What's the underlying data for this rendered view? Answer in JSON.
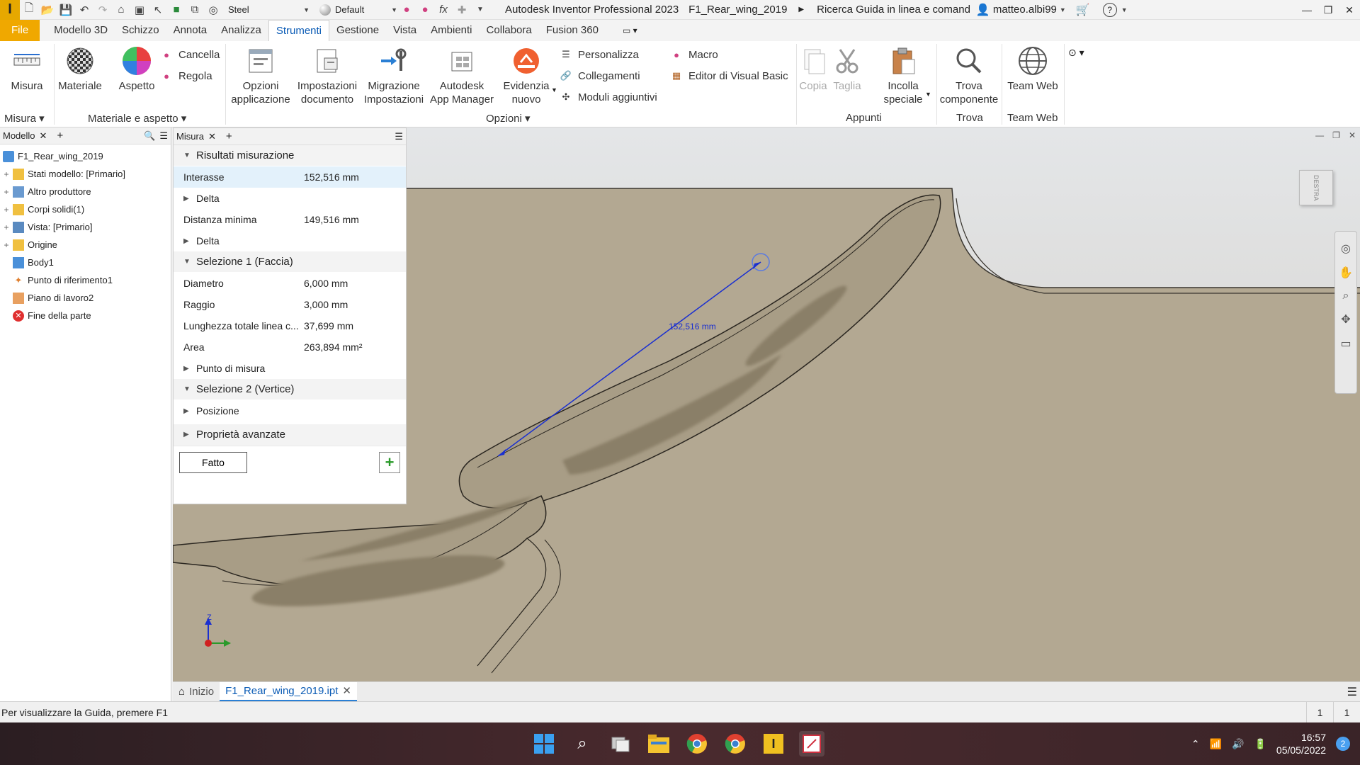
{
  "titlebar": {
    "material": "Steel",
    "appearance": "Default",
    "app_title": "Autodesk Inventor Professional 2023",
    "file_title": "F1_Rear_wing_2019",
    "search_help": "Ricerca Guida in linea e comand",
    "user": "matteo.albi99"
  },
  "ribbon_tabs": [
    "File",
    "Modello 3D",
    "Schizzo",
    "Annota",
    "Analizza",
    "Strumenti",
    "Gestione",
    "Vista",
    "Ambienti",
    "Collabora",
    "Fusion 360"
  ],
  "ribbon_active_tab": "Strumenti",
  "ribbon": {
    "misura": "Misura",
    "materiale": "Materiale",
    "aspetto": "Aspetto",
    "cancella": "Cancella",
    "regola": "Regola",
    "opzioni_app_1": "Opzioni",
    "opzioni_app_2": "applicazione",
    "impost_doc_1": "Impostazioni",
    "impost_doc_2": "documento",
    "migrazione_1": "Migrazione",
    "migrazione_2": "Impostazioni",
    "app_manager_1": "Autodesk",
    "app_manager_2": "App Manager",
    "evidenzia_1": "Evidenzia",
    "evidenzia_2": "nuovo",
    "personalizza": "Personalizza",
    "collegamenti": "Collegamenti",
    "moduli": "Moduli aggiuntivi",
    "macro": "Macro",
    "vba": "Editor di Visual Basic",
    "copia": "Copia",
    "taglia": "Taglia",
    "incolla_1": "Incolla",
    "incolla_2": "speciale",
    "trova_1": "Trova",
    "trova_2": "componente",
    "team_web": "Team Web",
    "groups": {
      "misura": "Misura",
      "materiale_aspetto": "Materiale e aspetto",
      "opzioni": "Opzioni",
      "appunti": "Appunti",
      "trova": "Trova",
      "team_web": "Team Web"
    }
  },
  "browser": {
    "tab": "Modello",
    "items": [
      {
        "label": "F1_Rear_wing_2019",
        "exp": "",
        "indent": 0
      },
      {
        "label": "Stati modello: [Primario]",
        "exp": "+",
        "indent": 1
      },
      {
        "label": "Altro produttore",
        "exp": "+",
        "indent": 1
      },
      {
        "label": "Corpi solidi(1)",
        "exp": "+",
        "indent": 1
      },
      {
        "label": "Vista: [Primario]",
        "exp": "+",
        "indent": 1
      },
      {
        "label": "Origine",
        "exp": "+",
        "indent": 1
      },
      {
        "label": "Body1",
        "exp": "",
        "indent": 1
      },
      {
        "label": "Punto di riferimento1",
        "exp": "",
        "indent": 1
      },
      {
        "label": "Piano di lavoro2",
        "exp": "",
        "indent": 1
      },
      {
        "label": "Fine della parte",
        "exp": "",
        "indent": 1
      }
    ]
  },
  "measure": {
    "tab": "Misura",
    "sec_results": "Risultati misurazione",
    "interasse_label": "Interasse",
    "interasse_val": "152,516 mm",
    "delta1": "Delta",
    "dist_min_label": "Distanza minima",
    "dist_min_val": "149,516 mm",
    "delta2": "Delta",
    "sec_sel1": "Selezione 1 (Faccia)",
    "diametro_label": "Diametro",
    "diametro_val": "6,000 mm",
    "raggio_label": "Raggio",
    "raggio_val": "3,000 mm",
    "lunghezza_label": "Lunghezza totale linea c...",
    "lunghezza_val": "37,699 mm",
    "area_label": "Area",
    "area_val": "263,894 mm²",
    "punto_misura": "Punto di misura",
    "sec_sel2": "Selezione 2 (Vertice)",
    "posizione": "Posizione",
    "sec_adv": "Proprietà avanzate",
    "done": "Fatto"
  },
  "viewport": {
    "dimension_label": "152,516 mm",
    "viewcube_label": "DESTRA",
    "axis_z": "Z"
  },
  "doctabs": {
    "home": "Inizio",
    "file": "F1_Rear_wing_2019.ipt"
  },
  "status": {
    "text": "Per visualizzare la Guida, premere F1",
    "num1": "1",
    "num2": "1"
  },
  "taskbar": {
    "time": "16:57",
    "date": "05/05/2022",
    "notifications": "2"
  }
}
